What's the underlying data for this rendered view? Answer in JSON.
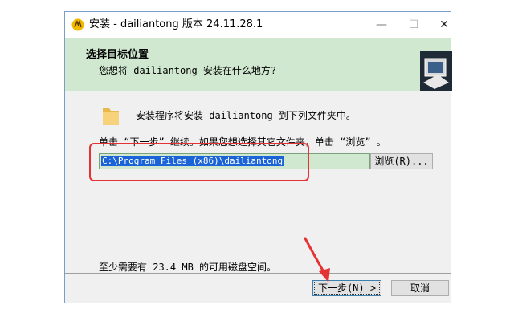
{
  "window": {
    "title": "安装 - dailiantong 版本 24.11.28.1"
  },
  "header": {
    "title": "选择目标位置",
    "subtitle": "您想将 dailiantong 安装在什么地方?"
  },
  "content": {
    "intro": "安装程序将安装 dailiantong 到下列文件夹中。",
    "instruction": "单击 “下一步” 继续。如果您想选择其它文件夹，单击 “浏览” 。",
    "path_value": "C:\\Program Files (x86)\\dailiantong",
    "browse_label": "浏览(R)...",
    "space_required": "至少需要有 23.4 MB 的可用磁盘空间。"
  },
  "buttons": {
    "next_label": "下一步(N) >",
    "cancel_label": "取消"
  },
  "colors": {
    "header_bg": "#cfe8cf",
    "highlight": "#e53333",
    "selection": "#1a64d8"
  },
  "icons": {
    "app": "app-icon",
    "folder": "folder-icon",
    "header": "installer-graphic-icon"
  }
}
